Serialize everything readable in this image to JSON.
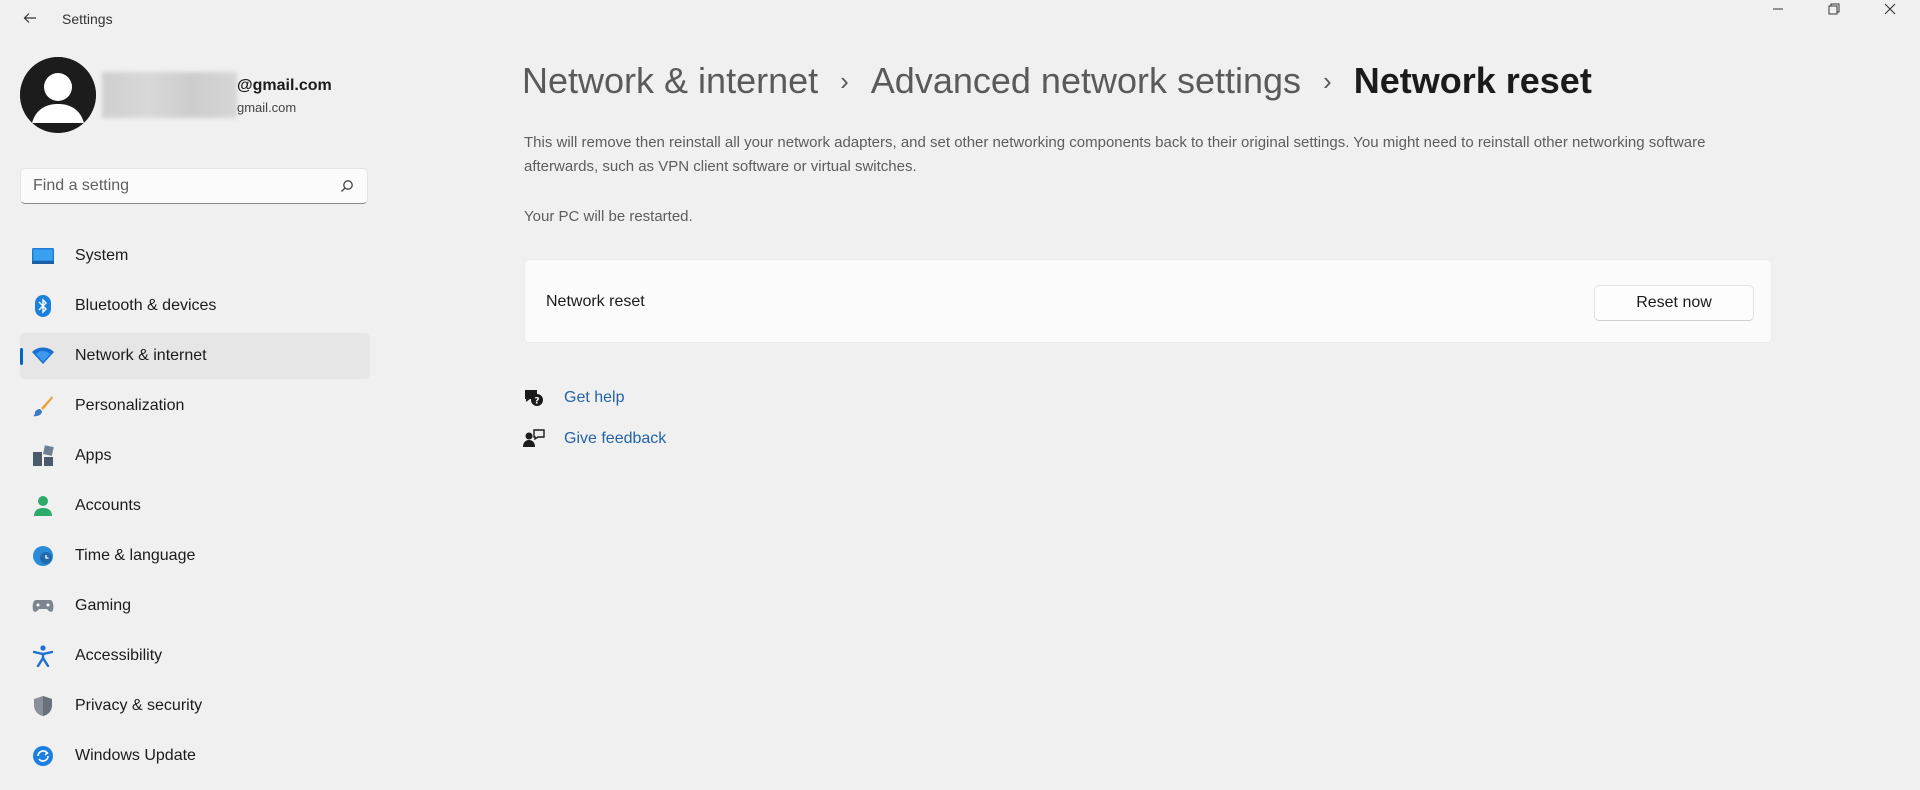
{
  "window": {
    "title": "Settings"
  },
  "profile": {
    "email": "@gmail.com",
    "email_sub": "gmail.com"
  },
  "search": {
    "placeholder": "Find a setting"
  },
  "sidebar": {
    "items": [
      {
        "label": "System",
        "icon": "system-icon"
      },
      {
        "label": "Bluetooth & devices",
        "icon": "bluetooth-icon"
      },
      {
        "label": "Network & internet",
        "icon": "wifi-icon",
        "active": true
      },
      {
        "label": "Personalization",
        "icon": "brush-icon"
      },
      {
        "label": "Apps",
        "icon": "apps-icon"
      },
      {
        "label": "Accounts",
        "icon": "person-icon"
      },
      {
        "label": "Time & language",
        "icon": "globe-clock-icon"
      },
      {
        "label": "Gaming",
        "icon": "gamepad-icon"
      },
      {
        "label": "Accessibility",
        "icon": "accessibility-icon"
      },
      {
        "label": "Privacy & security",
        "icon": "shield-icon"
      },
      {
        "label": "Windows Update",
        "icon": "update-icon"
      }
    ]
  },
  "breadcrumb": {
    "items": [
      "Network & internet",
      "Advanced network settings"
    ],
    "current": "Network reset"
  },
  "main": {
    "description": "This will remove then reinstall all your network adapters, and set other networking components back to their original settings. You might need to reinstall other networking software afterwards, such as VPN client software or virtual switches.",
    "restart_note": "Your PC will be restarted.",
    "card_label": "Network reset",
    "reset_button": "Reset now"
  },
  "links": {
    "get_help": "Get help",
    "give_feedback": "Give feedback"
  },
  "colors": {
    "accent": "#0067c0",
    "link": "#2464a6",
    "background": "#f0f0f0"
  }
}
